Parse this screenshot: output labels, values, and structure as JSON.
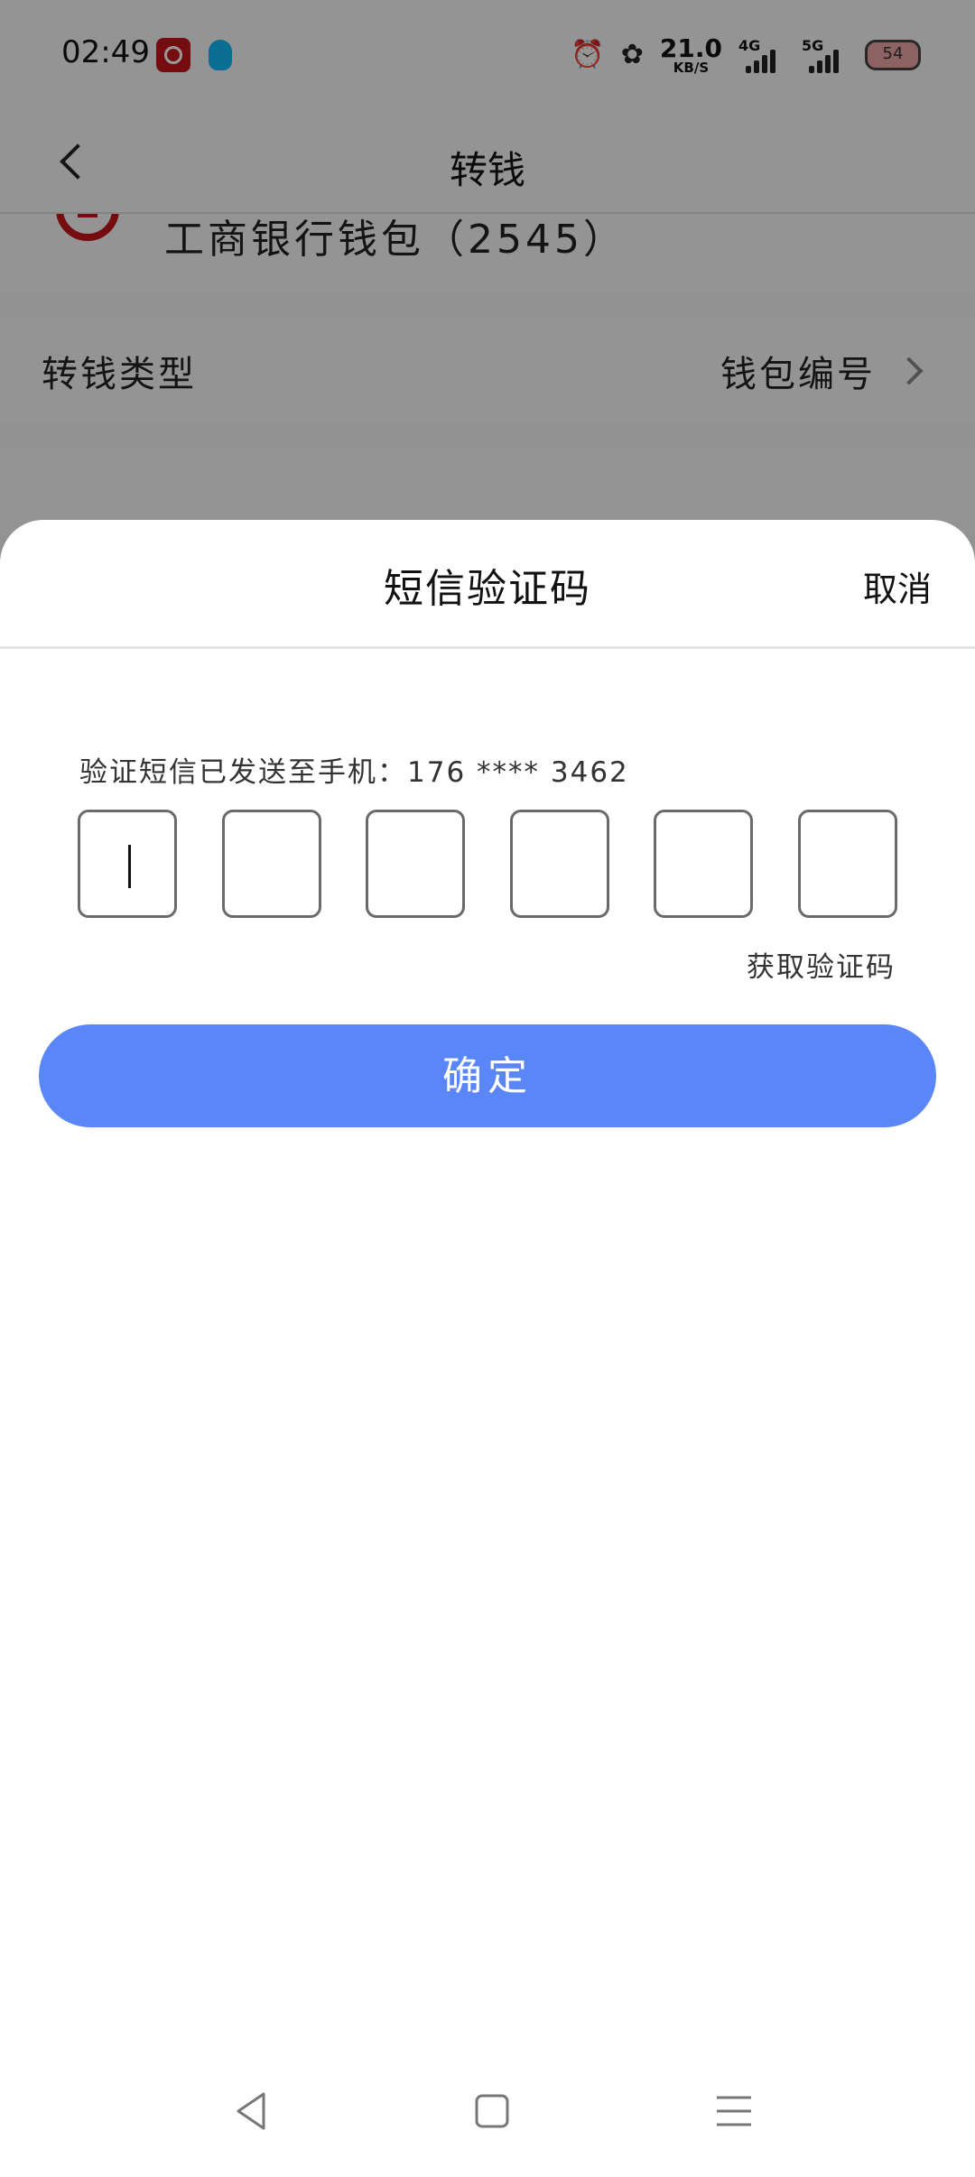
{
  "status_bar": {
    "time": "02:49",
    "speed_value": "21.0",
    "speed_unit": "KB/S",
    "net1_label": "4G",
    "net2_label": "5G",
    "battery_label": "54"
  },
  "header": {
    "title": "转钱"
  },
  "wallet": {
    "name": "工商银行钱包（2545）"
  },
  "transfer_type": {
    "label": "转钱类型",
    "value": "钱包编号"
  },
  "sheet": {
    "title": "短信验证码",
    "cancel_label": "取消",
    "sent_hint": "验证短信已发送至手机：176 **** 3462",
    "code_digits": [
      "",
      "",
      "",
      "",
      "",
      ""
    ],
    "get_code_label": "获取验证码",
    "confirm_label": "确定"
  },
  "colors": {
    "accent": "#5b86f7",
    "bank_red": "#c4161c",
    "qq_blue": "#12b7f5"
  }
}
